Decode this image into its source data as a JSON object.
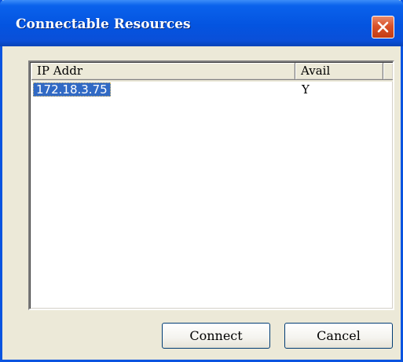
{
  "window": {
    "title": "Connectable Resources",
    "close_icon": "close-icon",
    "accent_color": "#0A54E0",
    "close_color": "#D9522A"
  },
  "list": {
    "columns": [
      "IP Addr",
      "Avail"
    ],
    "rows": [
      {
        "ip": "172.18.3.75",
        "avail": "Y",
        "selected": true
      }
    ],
    "selection_color": "#316AC5"
  },
  "buttons": {
    "connect_label": "Connect",
    "cancel_label": "Cancel"
  }
}
